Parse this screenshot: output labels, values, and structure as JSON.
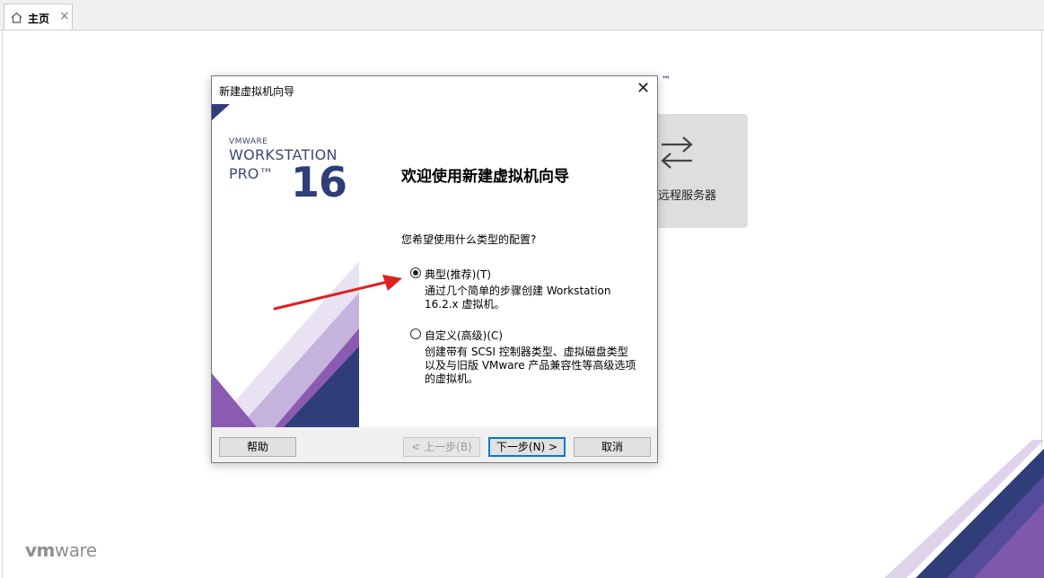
{
  "tab": {
    "label": "主页",
    "close": "×"
  },
  "background": {
    "remote_label": "远程服务器",
    "tm": "™",
    "logo_vm": "vm",
    "logo_ware": "ware"
  },
  "dialog": {
    "title": "新建虚拟机向导",
    "close": "✕",
    "banner": {
      "vendor": "VMWARE",
      "product": "WORKSTATION",
      "edition": "PRO™",
      "version": "16"
    },
    "welcome": "欢迎使用新建虚拟机向导",
    "question": "您希望使用什么类型的配置?",
    "options": [
      {
        "label": "典型(推荐)(T)",
        "selected": true,
        "desc_lines": [
          "通过几个简单的步骤创建 Workstation",
          "16.2.x 虚拟机。"
        ]
      },
      {
        "label": "自定义(高级)(C)",
        "selected": false,
        "desc_lines": [
          "创建带有 SCSI 控制器类型、虚拟磁盘类型",
          "以及与旧版 VMware 产品兼容性等高级选项",
          "的虚拟机。"
        ]
      }
    ],
    "buttons": {
      "help": "帮助",
      "back": "< 上一步(B)",
      "next": "下一步(N) >",
      "cancel": "取消"
    }
  },
  "colors": {
    "accent_blue": "#2f3d78",
    "accent_purple": "#7b4fa2",
    "annotation_arrow": "#e02020"
  }
}
